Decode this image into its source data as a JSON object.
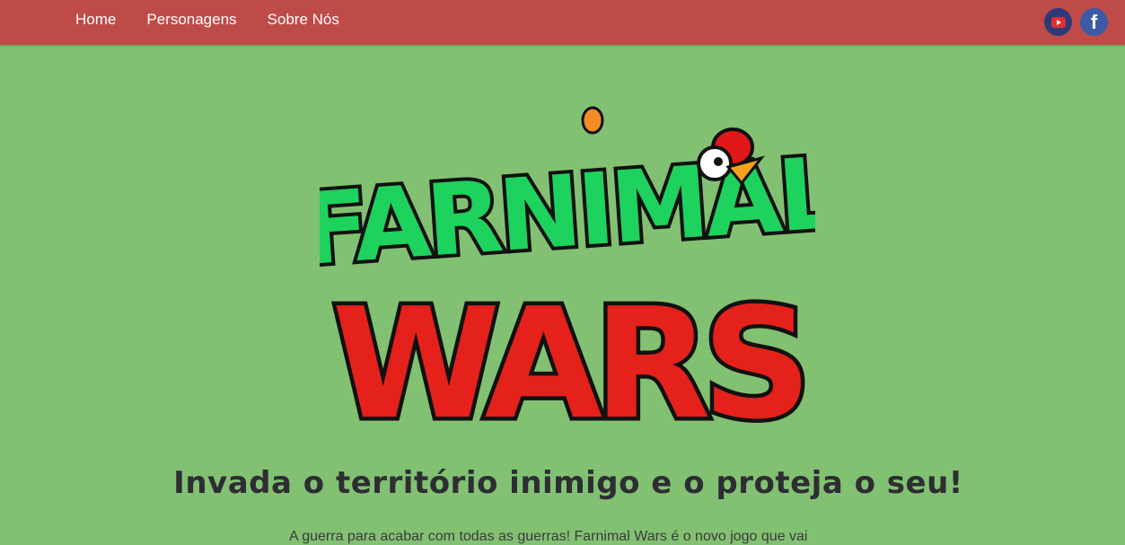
{
  "nav": {
    "links": [
      {
        "label": "Home"
      },
      {
        "label": "Personagens"
      },
      {
        "label": "Sobre Nós"
      }
    ],
    "social": [
      {
        "icon": "youtube-icon"
      },
      {
        "icon": "facebook-icon",
        "glyph": "f"
      }
    ]
  },
  "logo": {
    "line1": "FARNIMAL",
    "line2": "WARS"
  },
  "hero": {
    "headline": "Invada o território inimigo e o proteja o seu!",
    "intro": "A guerra para acabar com todas as guerras! Farnimal Wars é o novo jogo que vai"
  },
  "colors": {
    "nav_bg": "#bf4b48",
    "page_bg": "#82c172",
    "logo_green": "#1ed25e",
    "logo_red": "#e5211c"
  }
}
